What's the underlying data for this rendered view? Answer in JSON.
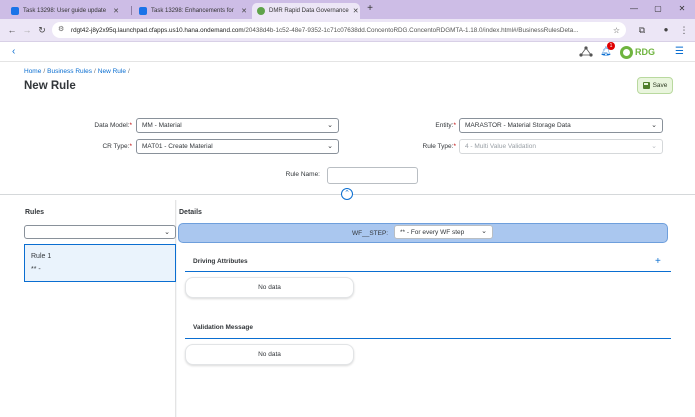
{
  "browser": {
    "tabs": [
      {
        "label": "Task 13298: User guide update",
        "active": false
      },
      {
        "label": "Task 13298: Enhancements for",
        "active": false
      },
      {
        "label": "DMR Rapid Data Governance",
        "active": true
      }
    ],
    "url_host": "rdgt42-j8y2x95q.launchpad.cfapps.us10.hana.ondemand.com",
    "url_path": "/20438d4b-1c52-48e7-9352-1c71c07638dd.ConcentoRDG.ConcentoRDGMTA-1.18.0/index.html#/BusinessRulesDeta..."
  },
  "shell": {
    "notification_count": "1",
    "logo_text": "RDG"
  },
  "header": {
    "breadcrumb": [
      "Home",
      "Business Rules",
      "New Rule"
    ],
    "title": "New Rule",
    "save_label": "Save"
  },
  "form": {
    "data_model_label": "Data Model:",
    "data_model_value": "MM - Material",
    "entity_label": "Entity:",
    "entity_value": "MARASTOR - Material Storage Data",
    "cr_type_label": "CR Type:",
    "cr_type_value": "MAT01 - Create Material",
    "rule_type_label": "Rule Type:",
    "rule_type_value": "4 - Multi Value Validation",
    "rule_name_label": "Rule Name:",
    "rule_name_value": ""
  },
  "rules": {
    "header": "Rules",
    "filter_value": "",
    "items": [
      {
        "name": "Rule 1",
        "sub": "** -"
      }
    ]
  },
  "details": {
    "header": "Details",
    "wf_step_label": "WF__STEP:",
    "wf_step_value": "** - For every WF step",
    "driving_title": "Driving Attributes",
    "driving_nodata": "No data",
    "validation_title": "Validation Message",
    "validation_nodata": "No data"
  },
  "colors": {
    "accent": "#0a6ed1",
    "save_bg": "#e9f5dd",
    "wf_bar": "#aac7ef",
    "brand_green": "#6fb43f",
    "tab_bar": "#cdbde6"
  }
}
